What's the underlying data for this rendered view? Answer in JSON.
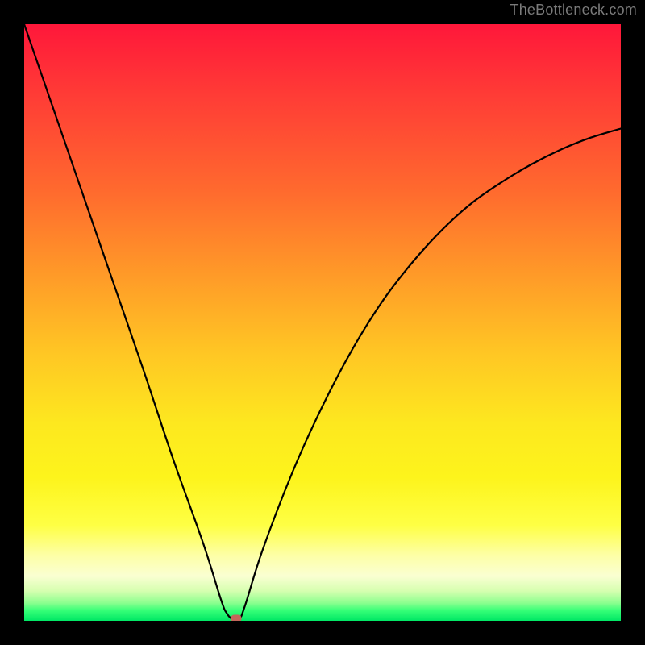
{
  "watermark": "TheBottleneck.com",
  "chart_data": {
    "type": "line",
    "title": "",
    "xlabel": "",
    "ylabel": "",
    "xlim": [
      0,
      100
    ],
    "ylim": [
      0,
      100
    ],
    "series": [
      {
        "name": "curve",
        "x": [
          0,
          5,
          10,
          15,
          20,
          25,
          30,
          33,
          34,
          35,
          36,
          37,
          40,
          45,
          50,
          55,
          60,
          65,
          70,
          75,
          80,
          85,
          90,
          95,
          100
        ],
        "values": [
          100,
          85.5,
          71,
          56.5,
          42,
          27,
          13,
          3.5,
          1.2,
          0.2,
          0.2,
          2.5,
          12,
          25,
          36,
          45.5,
          53.5,
          60,
          65.5,
          70,
          73.5,
          76.5,
          79,
          81,
          82.5
        ]
      }
    ],
    "marker": {
      "x": 35.5,
      "y": 0.4
    },
    "gradient_stops": [
      {
        "pct": 0,
        "color": "#ff173a"
      },
      {
        "pct": 12,
        "color": "#ff3c36"
      },
      {
        "pct": 28,
        "color": "#ff6a2e"
      },
      {
        "pct": 42,
        "color": "#ff9a28"
      },
      {
        "pct": 55,
        "color": "#ffc624"
      },
      {
        "pct": 67,
        "color": "#fde81f"
      },
      {
        "pct": 76,
        "color": "#fdf41c"
      },
      {
        "pct": 84,
        "color": "#feff44"
      },
      {
        "pct": 89,
        "color": "#fdffa6"
      },
      {
        "pct": 92.5,
        "color": "#faffd2"
      },
      {
        "pct": 95,
        "color": "#d6ffb0"
      },
      {
        "pct": 97,
        "color": "#8dff8f"
      },
      {
        "pct": 98.3,
        "color": "#35ff77"
      },
      {
        "pct": 100,
        "color": "#00e765"
      }
    ]
  }
}
